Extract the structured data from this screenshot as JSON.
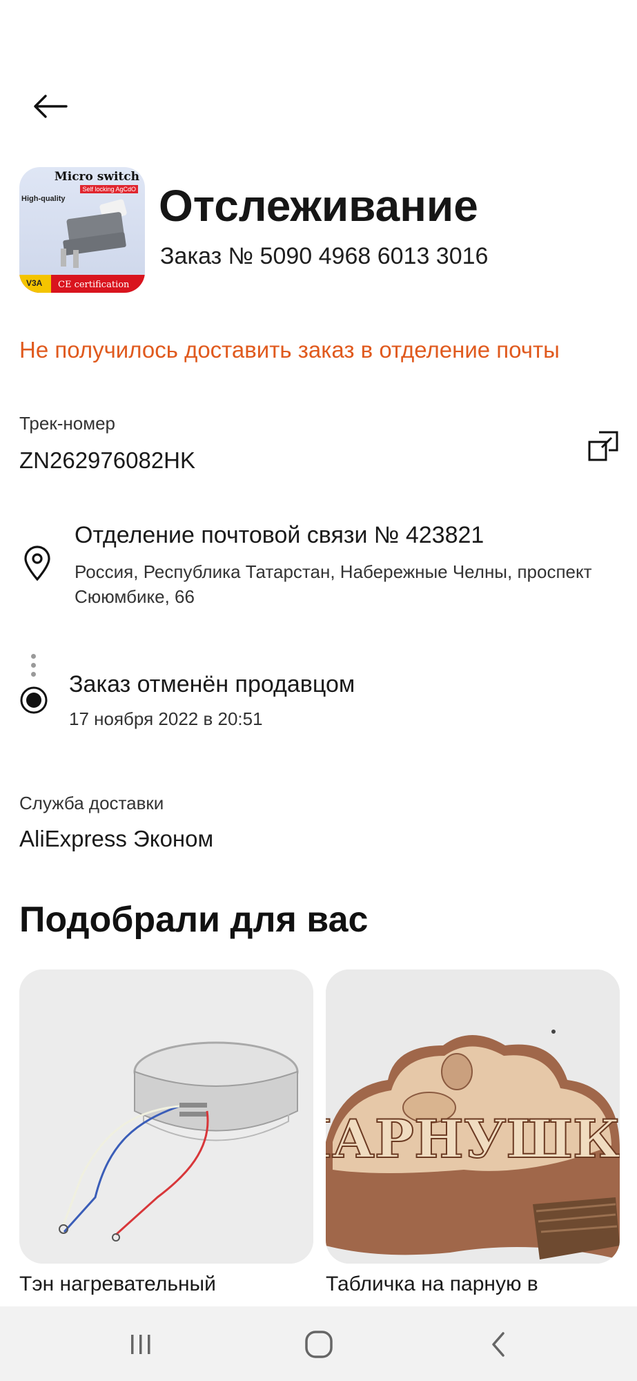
{
  "header": {
    "title": "Отслеживание",
    "order_number": "Заказ № 5090 4968 6013 3016",
    "thumbnail": {
      "title_text": "Micro switch",
      "sub_text": "Self locking AgCdO",
      "hq_text": "High-quality",
      "rating_text": "V3A",
      "cert_text": "CE certification"
    }
  },
  "status_message": "Не получилось доставить заказ в отделение почты",
  "tracking": {
    "label": "Трек-номер",
    "number": "ZN262976082HK",
    "copy_icon": "copy-icon"
  },
  "post_office": {
    "name": "Отделение почтовой связи № 423821",
    "address": "Россия, Республика Татарстан, Набережные Челны, проспект Сююмбике, 66",
    "icon": "location-pin-icon"
  },
  "event": {
    "title": "Заказ отменён продавцом",
    "date": "17 ноября 2022 в 20:51"
  },
  "delivery": {
    "label": "Служба доставки",
    "service": "AliExpress Эконом"
  },
  "recommendations": {
    "title": "Подобрали для вас",
    "items": [
      {
        "name": "Тэн нагревательный"
      },
      {
        "name": "Табличка на парную в",
        "image_text": "ПАРНУШКА"
      }
    ]
  },
  "colors": {
    "accent_error": "#e05a1e",
    "text_primary": "#1a1a1a",
    "navbar_bg": "#f2f2f2"
  },
  "navbar": {
    "icons": [
      "recent-apps-icon",
      "home-icon",
      "back-nav-icon"
    ]
  }
}
